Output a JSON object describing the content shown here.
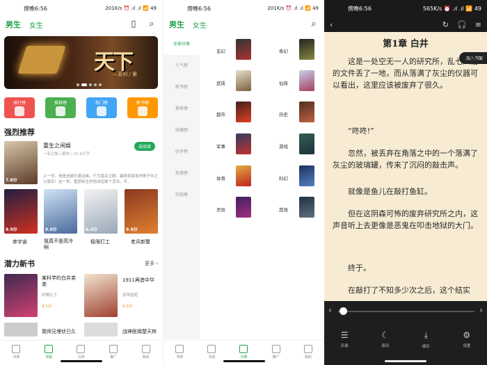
{
  "p1": {
    "status": {
      "time": "傍晚6:56",
      "right": "201K/s ⏰ .ıl .ıl 📶 49"
    },
    "tabs": {
      "male": "男生",
      "female": "女生"
    },
    "banner": {
      "title": "天下",
      "subtitle": "—系列 / 第"
    },
    "chips": [
      {
        "label": "排行榜",
        "color": "#ef5350"
      },
      {
        "label": "推荐榜",
        "color": "#4caf50"
      },
      {
        "label": "热门榜",
        "color": "#42a5f5"
      },
      {
        "label": "新书榜",
        "color": "#ff9800"
      }
    ],
    "strong": {
      "title": "强烈推荐",
      "featured": {
        "name": "重生之闲娱",
        "meta": "一亚之衡 | 都市 | 32.4万字",
        "button": "去阅读",
        "desc": "上一世，他是进娱乐圈边缘，只为我名立眼，最终却郭英帅男子中之公豪后！这一世，重获新生的他决定挨个活法，不...",
        "score": "7.8分"
      },
      "books": [
        {
          "name": "弃宇宙",
          "score": "9.9分"
        },
        {
          "name": "我真不是高冷啊",
          "score": "9.9分"
        },
        {
          "name": "极限打工",
          "score": "6.3分"
        },
        {
          "name": "老兵新警",
          "score": "9.9分"
        }
      ]
    },
    "potential": {
      "title": "潜力新书",
      "more": "更多",
      "books": [
        {
          "name": "某科学的白井弟弟",
          "author": "好糟丸子",
          "score": "9.1分"
        },
        {
          "name": "1911再造中华",
          "author": "南草眉翅",
          "score": "9.3分"
        },
        {
          "name": "我师兄埋伏已久",
          "author": "",
          "score": ""
        },
        {
          "name": "战神医婿楚天林",
          "author": "",
          "score": ""
        }
      ]
    },
    "tabbar": [
      "书架",
      "书城",
      "分类",
      "推广",
      "我的"
    ]
  },
  "p2": {
    "status": {
      "time": "傍晚6:56",
      "right": "201K/s ⏰ .ıl .ıl 📶 49"
    },
    "tabs": {
      "male": "男生",
      "female": "女生"
    },
    "side": [
      "全部分类",
      "人气榜",
      "新书榜",
      "推荐榜",
      "收藏榜",
      "好评榜",
      "热搜榜",
      "完结榜"
    ],
    "cats": [
      [
        "玄幻",
        "奇幻"
      ],
      [
        "武侠",
        "仙侠"
      ],
      [
        "都市",
        "历史"
      ],
      [
        "军事",
        "游戏"
      ],
      [
        "体育",
        "科幻"
      ],
      [
        "灵异",
        "其他"
      ]
    ],
    "tabbar": [
      "书架",
      "书城",
      "分类",
      "推广",
      "我的"
    ]
  },
  "p3": {
    "status": {
      "time": "傍晚6:56",
      "right": "565K/s ⏰ .ıl .ıl 📶 49"
    },
    "chapter": "第1章 白井",
    "shelf": "加入书架",
    "paras": [
      "这是一处空无一人的研究所，乱七八糟的文件丢了一地，而从落满了灰尘的仪器可以看出，这里应该被废弃了很久。",
      "“咚咚!”",
      "忽然，被丢弃在角落之中的一个落满了灰尘的玻璃罐，传来了沉闷的敲击声。",
      "就像是鱼儿在敲打鱼缸。",
      "但在这阴森可怖的废弃研究所之内，这声音听上去更像是恶鬼在叩击地狱的大门。",
      "终于。",
      "在敲打了不知多少次之后，这个结实"
    ],
    "bottom": [
      "目录",
      "夜间",
      "缓存",
      "设置"
    ]
  },
  "colors": {
    "accent": "#1fa34a",
    "paper": "#f7ecd3"
  }
}
